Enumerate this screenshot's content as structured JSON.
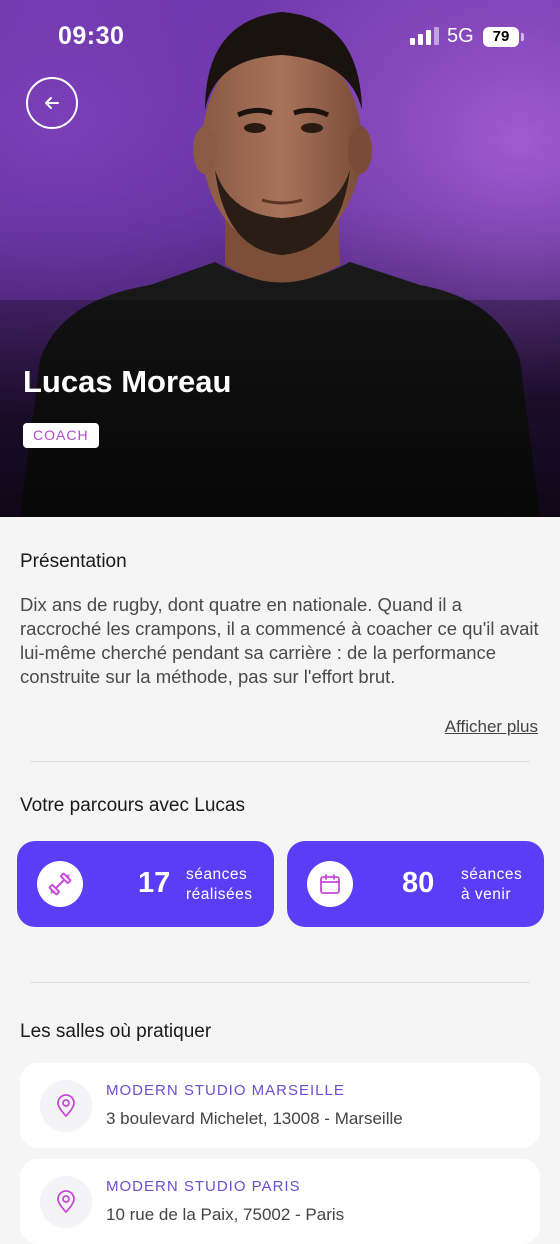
{
  "status_bar": {
    "time": "09:30",
    "network": "5G",
    "battery": "79"
  },
  "coach": {
    "name": "Lucas Moreau",
    "role": "COACH"
  },
  "presentation": {
    "title": "Présentation",
    "text": "Dix ans de rugby, dont quatre en nationale. Quand il a raccroché les crampons, il a commencé à coacher ce qu'il avait lui-même cherché pendant sa carrière : de la performance construite sur la méthode, pas sur l'effort brut.",
    "show_more": "Afficher plus"
  },
  "journey": {
    "title": "Votre parcours avec Lucas",
    "stats": [
      {
        "icon": "dumbbell-icon",
        "value": "17",
        "label_line1": "séances",
        "label_line2": "réalisées"
      },
      {
        "icon": "calendar-icon",
        "value": "80",
        "label_line1": "séances",
        "label_line2": "à venir"
      }
    ]
  },
  "gyms": {
    "title": "Les salles où pratiquer",
    "items": [
      {
        "name": "MODERN STUDIO MARSEILLE",
        "address": "3 boulevard Michelet, 13008 - Marseille"
      },
      {
        "name": "MODERN STUDIO PARIS",
        "address": "10 rue de la Paix, 75002 - Paris"
      }
    ]
  },
  "colors": {
    "accent": "#5b3df5",
    "badge_text": "#b14ad0",
    "gym_name": "#6a4fd0"
  }
}
